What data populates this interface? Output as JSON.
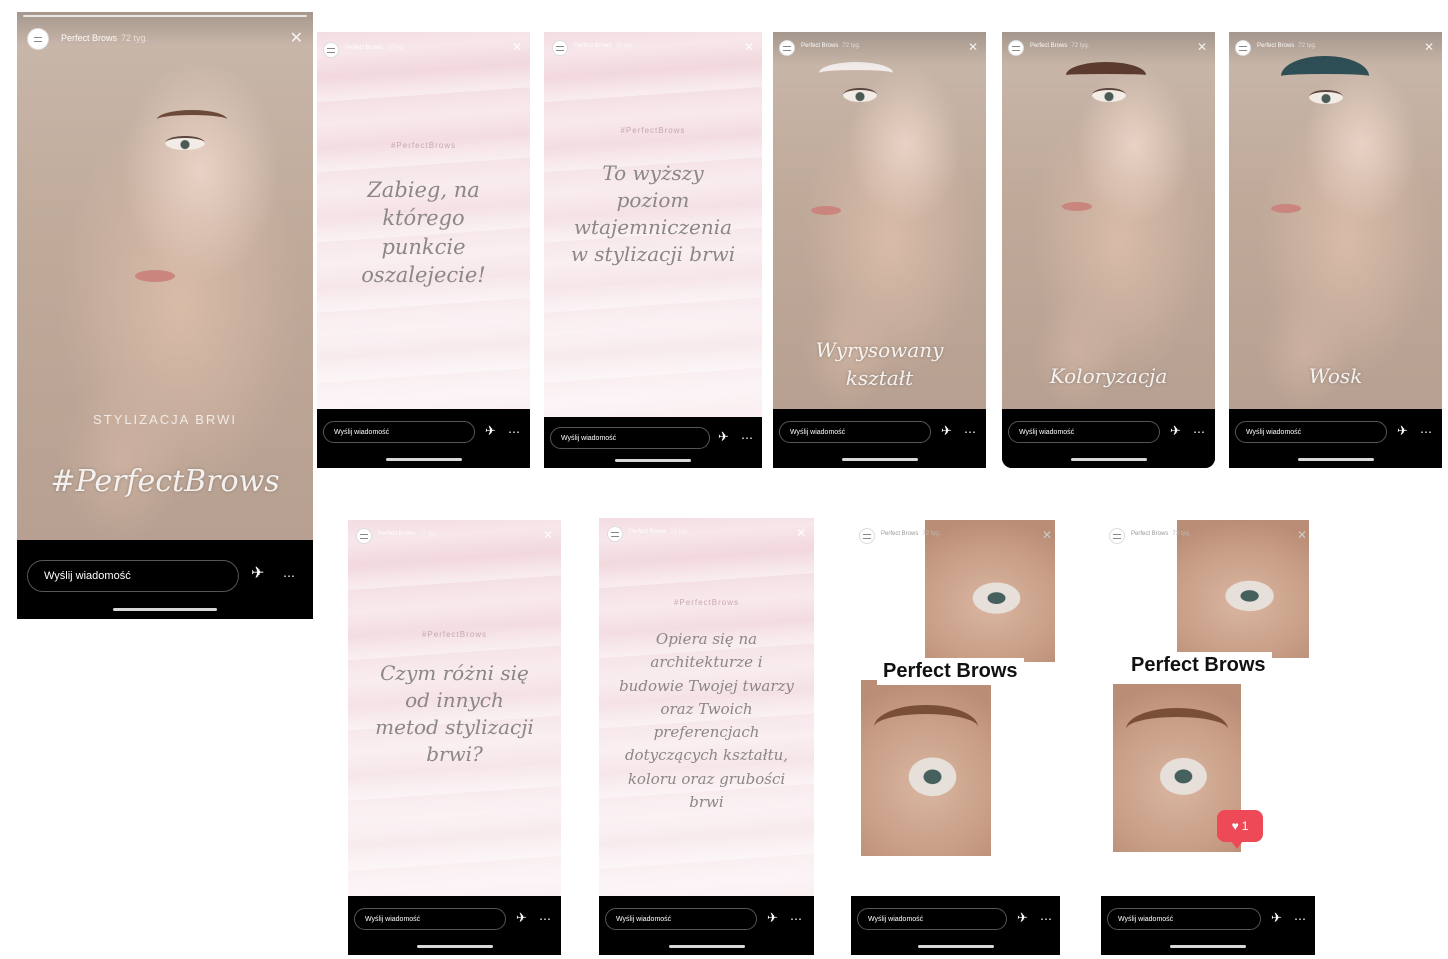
{
  "common": {
    "account_name": "Perfect Brows",
    "timestamp": "72 tyg.",
    "message_placeholder": "Wyślij wiadomość",
    "close_glyph": "✕",
    "send_glyph": "✈",
    "more_glyph": "⋯"
  },
  "stories": [
    {
      "id": "s1",
      "subtitle": "STYLIZACJA BRWI",
      "title": "#PerfectBrows"
    },
    {
      "id": "s2",
      "hashtag": "#PerfectBrows",
      "text": "Zabieg, na którego punkcie oszalejecie!"
    },
    {
      "id": "s3",
      "hashtag": "#PerfectBrows",
      "text": "To wyższy poziom wtajemniczenia w stylizacji brwi"
    },
    {
      "id": "s4",
      "overlay": "Wyrysowany kształt"
    },
    {
      "id": "s5",
      "overlay": "Koloryzacja"
    },
    {
      "id": "s6",
      "overlay": "Wosk"
    },
    {
      "id": "s7",
      "hashtag": "#PerfectBrows",
      "text": "Czym różni się od innych metod stylizacji brwi?"
    },
    {
      "id": "s8",
      "hashtag": "#PerfectBrows",
      "text": "Opiera się na architekturze i budowie Twojej twarzy oraz Twoich preferencjach dotyczących kształtu, koloru oraz grubości brwi"
    },
    {
      "id": "s9",
      "title": "Perfect Brows"
    },
    {
      "id": "s10",
      "title": "Perfect Brows",
      "like_count": "1"
    }
  ],
  "colors": {
    "bar_bg": "#000000",
    "pink_bg": "#f3dde2",
    "like_red": "#ed4956",
    "brow_dye": "#2f4f56"
  }
}
